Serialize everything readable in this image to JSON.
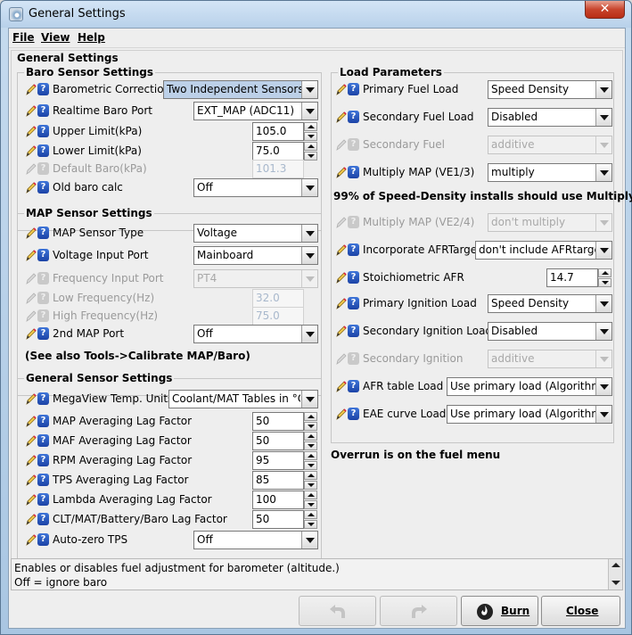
{
  "window": {
    "title": "General Settings"
  },
  "menu": {
    "file": "File",
    "view": "View",
    "help": "Help"
  },
  "main_title": "General Settings",
  "baro": {
    "title": "Baro Sensor Settings",
    "barometric_correction": {
      "label": "Barometric Correction",
      "value": "Two Independent Sensors"
    },
    "realtime_baro_port": {
      "label": "Realtime Baro Port",
      "value": "EXT_MAP (ADC11)"
    },
    "upper_limit": {
      "label": "Upper Limit(kPa)",
      "value": "105.0"
    },
    "lower_limit": {
      "label": "Lower Limit(kPa)",
      "value": "75.0"
    },
    "default_baro": {
      "label": "Default Baro(kPa)",
      "value": "101.3"
    },
    "old_baro_calc": {
      "label": "Old baro calc",
      "value": "Off"
    }
  },
  "map": {
    "title": "MAP Sensor Settings",
    "sensor_type": {
      "label": "MAP Sensor Type",
      "value": "Voltage"
    },
    "voltage_input_port": {
      "label": "Voltage Input Port",
      "value": "Mainboard"
    },
    "frequency_input_port": {
      "label": "Frequency Input Port",
      "value": "PT4"
    },
    "low_frequency": {
      "label": "Low Frequency(Hz)",
      "value": "32.0"
    },
    "high_frequency": {
      "label": "High Frequency(Hz)",
      "value": "75.0"
    },
    "second_map_port": {
      "label": "2nd MAP Port",
      "value": "Off"
    },
    "note": "(See also Tools->Calibrate MAP/Baro)"
  },
  "gen": {
    "title": "General Sensor Settings",
    "megaview_units": {
      "label": "MegaView Temp. Units",
      "value": "Coolant/MAT Tables in °C"
    },
    "map_lag": {
      "label": "MAP Averaging Lag Factor",
      "value": "50"
    },
    "maf_lag": {
      "label": "MAF Averaging Lag Factor",
      "value": "50"
    },
    "rpm_lag": {
      "label": "RPM Averaging Lag Factor",
      "value": "95"
    },
    "tps_lag": {
      "label": "TPS Averaging Lag Factor",
      "value": "85"
    },
    "lambda_lag": {
      "label": "Lambda Averaging Lag Factor",
      "value": "100"
    },
    "clt_lag": {
      "label": "CLT/MAT/Battery/Baro Lag Factor",
      "value": "50"
    },
    "autozero_tps": {
      "label": "Auto-zero TPS",
      "value": "Off"
    }
  },
  "load": {
    "title": "Load Parameters",
    "primary_fuel_load": {
      "label": "Primary Fuel Load",
      "value": "Speed Density"
    },
    "secondary_fuel_load": {
      "label": "Secondary Fuel Load",
      "value": "Disabled"
    },
    "secondary_fuel": {
      "label": "Secondary Fuel",
      "value": "additive"
    },
    "multiply_map_13": {
      "label": "Multiply MAP (VE1/3)",
      "value": "multiply"
    },
    "note1": "99% of Speed-Density installs should use Multiply",
    "multiply_map_24": {
      "label": "Multiply MAP (VE2/4)",
      "value": "don't multiply"
    },
    "incorporate_afr": {
      "label": "Incorporate AFRTarget",
      "value": "don't include AFRtarget"
    },
    "stoich_afr": {
      "label": "Stoichiometric AFR",
      "value": "14.7"
    },
    "primary_ign_load": {
      "label": "Primary Ignition Load",
      "value": "Speed Density"
    },
    "secondary_ign_load": {
      "label": "Secondary Ignition Load",
      "value": "Disabled"
    },
    "secondary_ign": {
      "label": "Secondary Ignition",
      "value": "additive"
    },
    "afr_table_load": {
      "label": "AFR table Load",
      "value": "Use primary load (Algorithm)"
    },
    "eae_curve_load": {
      "label": "EAE curve Load",
      "value": "Use primary load (Algorithm)"
    }
  },
  "overrun_note": "Overrun is on the fuel menu",
  "status": {
    "line1": "Enables or disables fuel adjustment for barometer (altitude.)",
    "line2": "Off = ignore baro"
  },
  "buttons": {
    "burn": "Burn",
    "close": "Close"
  }
}
